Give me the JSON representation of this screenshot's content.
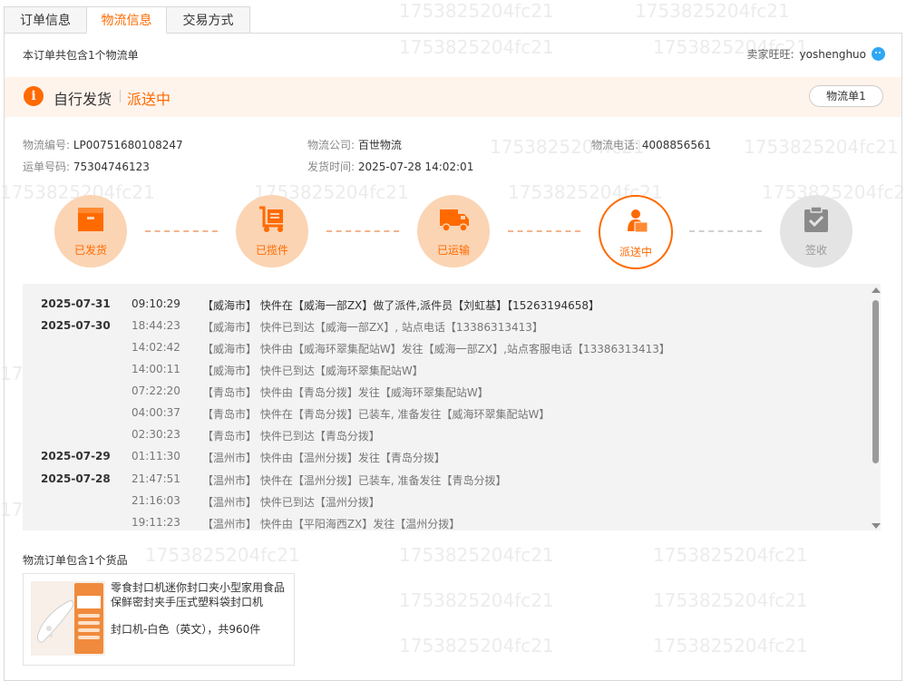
{
  "tabs": [
    {
      "label": "订单信息",
      "active": false
    },
    {
      "label": "物流信息",
      "active": true
    },
    {
      "label": "交易方式",
      "active": false
    }
  ],
  "summary": "本订单共包含1个物流单",
  "seller": {
    "label": "卖家旺旺:",
    "name": "yoshenghuo"
  },
  "banner": {
    "type": "自行发货",
    "status": "派送中",
    "waybill_button": "物流单1"
  },
  "shipment": {
    "no_label": "物流编号:",
    "no": "LP00751680108247",
    "company_label": "物流公司:",
    "company": "百世物流",
    "phone_label": "物流电话:",
    "phone": "4008856561",
    "tracking_label": "运单号码:",
    "tracking": "75304746123",
    "time_label": "发货时间:",
    "time": "2025-07-28 14:02:01"
  },
  "steps": [
    {
      "label": "已发货",
      "state": "done",
      "icon": "box-icon"
    },
    {
      "label": "已揽件",
      "state": "done",
      "icon": "cart-icon"
    },
    {
      "label": "已运输",
      "state": "done",
      "icon": "truck-icon"
    },
    {
      "label": "派送中",
      "state": "current",
      "icon": "courier-icon"
    },
    {
      "label": "签收",
      "state": "todo",
      "icon": "clipboard-check-icon"
    }
  ],
  "tracking_events": [
    {
      "date": "2025-07-31",
      "time": "09:10:29",
      "text": "【威海市】 快件在【威海一部ZX】做了派件,派件员【刘虹基】【15263194658】"
    },
    {
      "date": "2025-07-30",
      "time": "18:44:23",
      "text": "【威海市】 快件已到达【威海一部ZX】, 站点电话【13386313413】"
    },
    {
      "date": "",
      "time": "14:02:42",
      "text": "【威海市】 快件由【威海环翠集配站W】发往【威海一部ZX】,站点客服电话【13386313413】"
    },
    {
      "date": "",
      "time": "14:00:11",
      "text": "【威海市】 快件已到达【威海环翠集配站W】"
    },
    {
      "date": "",
      "time": "07:22:20",
      "text": "【青岛市】 快件由【青岛分拨】发往【威海环翠集配站W】"
    },
    {
      "date": "",
      "time": "04:00:37",
      "text": "【青岛市】 快件在【青岛分拨】已装车, 准备发往【威海环翠集配站W】"
    },
    {
      "date": "",
      "time": "02:30:23",
      "text": "【青岛市】 快件已到达【青岛分拨】"
    },
    {
      "date": "2025-07-29",
      "time": "01:11:30",
      "text": "【温州市】 快件由【温州分拨】发往【青岛分拨】"
    },
    {
      "date": "2025-07-28",
      "time": "21:47:51",
      "text": "【温州市】 快件在【温州分拨】已装车, 准备发往【青岛分拨】"
    },
    {
      "date": "",
      "time": "21:16:03",
      "text": "【温州市】 快件已到达【温州分拨】"
    },
    {
      "date": "",
      "time": "19:11:23",
      "text": "【温州市】 快件由【平阳海西ZX】发往【温州分拨】"
    }
  ],
  "goods_section": {
    "title": "物流订单包含1个货品",
    "item": {
      "name": "零食封口机迷你封口夹小型家用食品保鲜密封夹手压式塑料袋封口机",
      "spec": "封口机-白色（英文），共960件"
    }
  },
  "watermark": "1753825204fc21",
  "colors": {
    "accent": "#ff6a00",
    "banner_bg": "#fff4ec",
    "step_done": "#fbd4b3",
    "step_todo": "#e4e4e4"
  }
}
